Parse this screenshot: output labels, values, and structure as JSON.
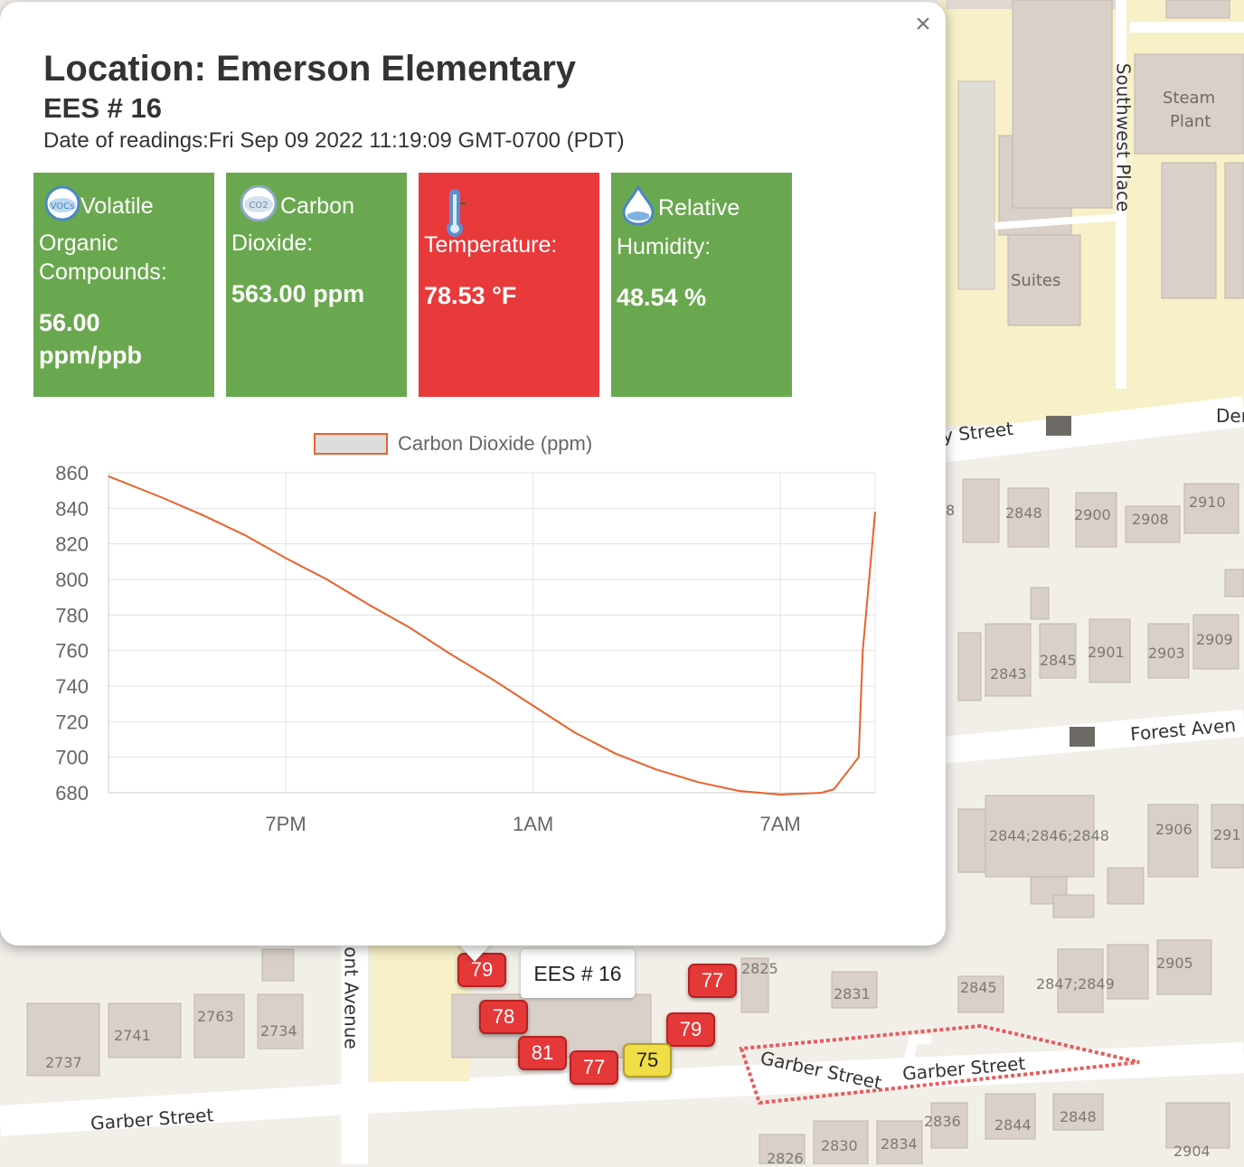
{
  "map": {
    "streets": [
      "y Street",
      "Forest Aven",
      "Garber Street",
      "Garber Street",
      "Garber Street",
      "ont Avenue",
      "Southwest Place",
      "Der"
    ],
    "places": [
      "Steam",
      "Plant",
      "Suites"
    ],
    "house_numbers": [
      "2848",
      "2900",
      "2908",
      "2910",
      "2845",
      "2901",
      "2903",
      "2909",
      "2843",
      "2844;2846;2848",
      "2906",
      "291",
      "2905",
      "2845",
      "2847;2849",
      "2831",
      "2825",
      "2763",
      "2741",
      "2734",
      "2737",
      "2836",
      "2844",
      "2848",
      "2830",
      "2834",
      "2826",
      "2904",
      "8"
    ],
    "markers": [
      {
        "value": "79",
        "color": "#e53838"
      },
      {
        "value": "77",
        "color": "#e53838"
      },
      {
        "value": "78",
        "color": "#e53838"
      },
      {
        "value": "79",
        "color": "#e53838"
      },
      {
        "value": "81",
        "color": "#e53838"
      },
      {
        "value": "77",
        "color": "#e53838"
      },
      {
        "value": "75",
        "color": "#f0dd47"
      }
    ],
    "tooltip": "EES # 16"
  },
  "popup": {
    "close_symbol": "×",
    "title": "Location: Emerson Elementary",
    "sensor": "EES # 16",
    "date_line": "Date of readings:Fri Sep 09 2022 11:19:09 GMT-0700 (PDT)",
    "tiles": [
      {
        "icon": "voc-icon",
        "label": "Volatile Organic Compounds:",
        "value": "56.00 ppm/ppb",
        "color": "#6aa84f"
      },
      {
        "icon": "co2-icon",
        "label": "Carbon Dioxide:",
        "value": "563.00 ppm",
        "color": "#6aa84f"
      },
      {
        "icon": "thermometer-icon",
        "label": "Temperature:",
        "value": "78.53 °F",
        "color": "#e8393b"
      },
      {
        "icon": "water-drop-icon",
        "label": "Relative Humidity:",
        "value": "48.54 %",
        "color": "#6aa84f"
      }
    ]
  },
  "chart_data": {
    "type": "line",
    "legend": "Carbon Dioxide (ppm)",
    "legend_position": "top-center",
    "grid": true,
    "ylim": [
      680,
      860
    ],
    "y_ticks": [
      860,
      840,
      820,
      800,
      780,
      760,
      740,
      720,
      700,
      680
    ],
    "x_tick_labels": [
      "7PM",
      "1AM",
      "7AM"
    ],
    "series": [
      {
        "name": "Carbon Dioxide (ppm)",
        "color": "#e8622b",
        "x_hours": [
          14.7,
          16.0,
          17.0,
          18.0,
          19.0,
          20.0,
          21.0,
          22.0,
          23.0,
          24.0,
          25.0,
          26.0,
          27.0,
          28.0,
          29.0,
          30.0,
          31.0,
          32.0,
          32.3,
          32.9,
          33.0,
          33.3
        ],
        "y": [
          858,
          846,
          836,
          825,
          812,
          800,
          786,
          773,
          758,
          744,
          729,
          714,
          702,
          693,
          686,
          681,
          679,
          680,
          682,
          700,
          760,
          838
        ]
      }
    ]
  }
}
